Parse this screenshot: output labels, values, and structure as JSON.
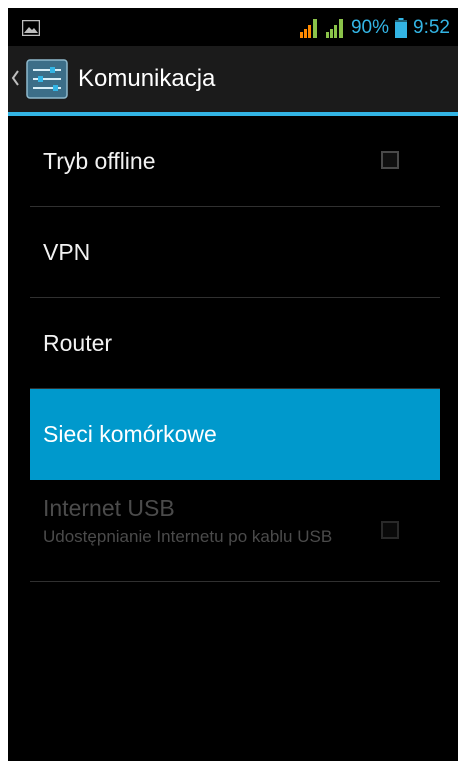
{
  "status_bar": {
    "battery_percent": "90%",
    "time": "9:52",
    "accent_color": "#33b5e5",
    "signal_1_colors": [
      "#ff8a00",
      "#8bc34a"
    ],
    "signal_2_color": "#8bc34a",
    "battery_level": 0.9,
    "icons": [
      "gallery-icon",
      "signal-icon",
      "signal-icon",
      "battery-icon"
    ]
  },
  "action_bar": {
    "title": "Komunikacja",
    "icons": [
      "chevron-left-icon",
      "settings-sliders-icon"
    ]
  },
  "preferences": [
    {
      "title": "Tryb offline",
      "checkbox": true,
      "checked": false
    },
    {
      "title": "VPN"
    },
    {
      "title": "Router"
    },
    {
      "title": "Sieci komórkowe",
      "selected": true,
      "highlight_color": "#0099cc"
    },
    {
      "title": "Internet USB",
      "summary": "Udostępnianie Internetu po kablu USB",
      "checkbox": true,
      "checked": false,
      "enabled": false
    }
  ]
}
